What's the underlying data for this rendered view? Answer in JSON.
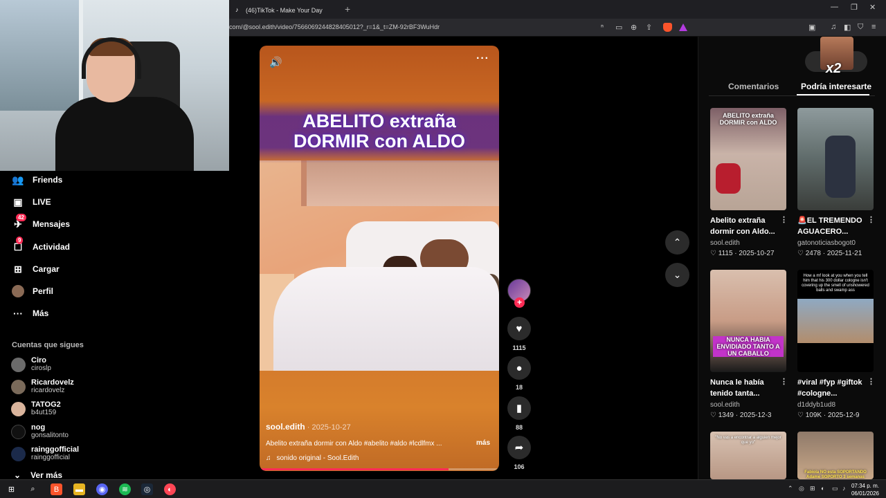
{
  "browser": {
    "tab_title": "(46)TikTok - Make Your Day",
    "url": "com/@sool.edith/video/7566069244828405012?_r=1&_t=ZM-92rBF3WuHdr"
  },
  "sidebar": {
    "items": [
      {
        "label": "Friends",
        "icon": "friends-icon"
      },
      {
        "label": "LIVE",
        "icon": "live-icon"
      },
      {
        "label": "Mensajes",
        "icon": "messages-icon",
        "badge": "42"
      },
      {
        "label": "Actividad",
        "icon": "activity-icon",
        "badge": "9"
      },
      {
        "label": "Cargar",
        "icon": "upload-icon"
      },
      {
        "label": "Perfil",
        "icon": "profile-avatar"
      },
      {
        "label": "Más",
        "icon": "more-dots-icon"
      }
    ],
    "following_title": "Cuentas que sigues",
    "accounts": [
      {
        "name": "Ciro",
        "handle": "ciroslp"
      },
      {
        "name": "Ricardovelz",
        "handle": "ricardovelz"
      },
      {
        "name": "TATOG2",
        "handle": "b4ut159"
      },
      {
        "name": "nog",
        "handle": "gonsalitonto"
      },
      {
        "name": "rainggofficial",
        "handle": "rainggofficial"
      }
    ],
    "see_more": "Ver más"
  },
  "video": {
    "overlay_title_line1": "ABELITO extraña",
    "overlay_title_line2": "DORMIR con ALDO",
    "author": "sool.edith",
    "date": " · 2025-10-27",
    "caption": "Abelito extraña dormir con Aldo #abelito #aldo #lcdlfmx ...",
    "more": "más",
    "sound": "sonido original - Sool.Edith",
    "progress": 0.79
  },
  "actions": {
    "likes": "1115",
    "comments": "18",
    "saves": "88",
    "shares": "106"
  },
  "right_panel": {
    "tabs": [
      "Comentarios",
      "Podría interesarte"
    ],
    "overlay_label": "x2",
    "cards": [
      {
        "thumb_text": "ABELITO extraña DORMIR con ALDO",
        "title": "Abelito extraña dormir con Aldo...",
        "author": "sool.edith",
        "likes": "1115",
        "date": "2025-10-27"
      },
      {
        "thumb_text": "",
        "title": "🚨EL TREMENDO AGUACERO...",
        "author": "gatonoticiasbogot0",
        "likes": "2478",
        "date": "2025-11-21"
      },
      {
        "thumb_text": "NUNCA HABIA ENVIDIADO TANTO A UN CABALLO",
        "title": "Nunca le había tenido tanta...",
        "author": "sool.edith",
        "likes": "1349",
        "date": "2025-12-3"
      },
      {
        "thumb_text": "How a mf look at you when you tell him that his 300 dollar cologne isn't covering up the smell of unshowered balls and swamp ass",
        "title": "#viral #fyp #giftok #cologne...",
        "author": "d1ddyb1ud8",
        "likes": "109K",
        "date": "2025-12-9"
      },
      {
        "thumb_text": "\"No vas a encontrar a alguien mejor que yo\"",
        "title": "",
        "author": "",
        "likes": "",
        "date": ""
      },
      {
        "thumb_text": "Fabiola NO esta SOPORTANDO Adame SOPORTO 3 semanas",
        "title": "",
        "author": "",
        "likes": "",
        "date": ""
      }
    ]
  },
  "taskbar": {
    "time": "07:34 p. m.",
    "date": "06/01/2026"
  },
  "colors": {
    "accent": "#fe2c55",
    "background": "#000000",
    "panel": "#2b2b2b"
  }
}
